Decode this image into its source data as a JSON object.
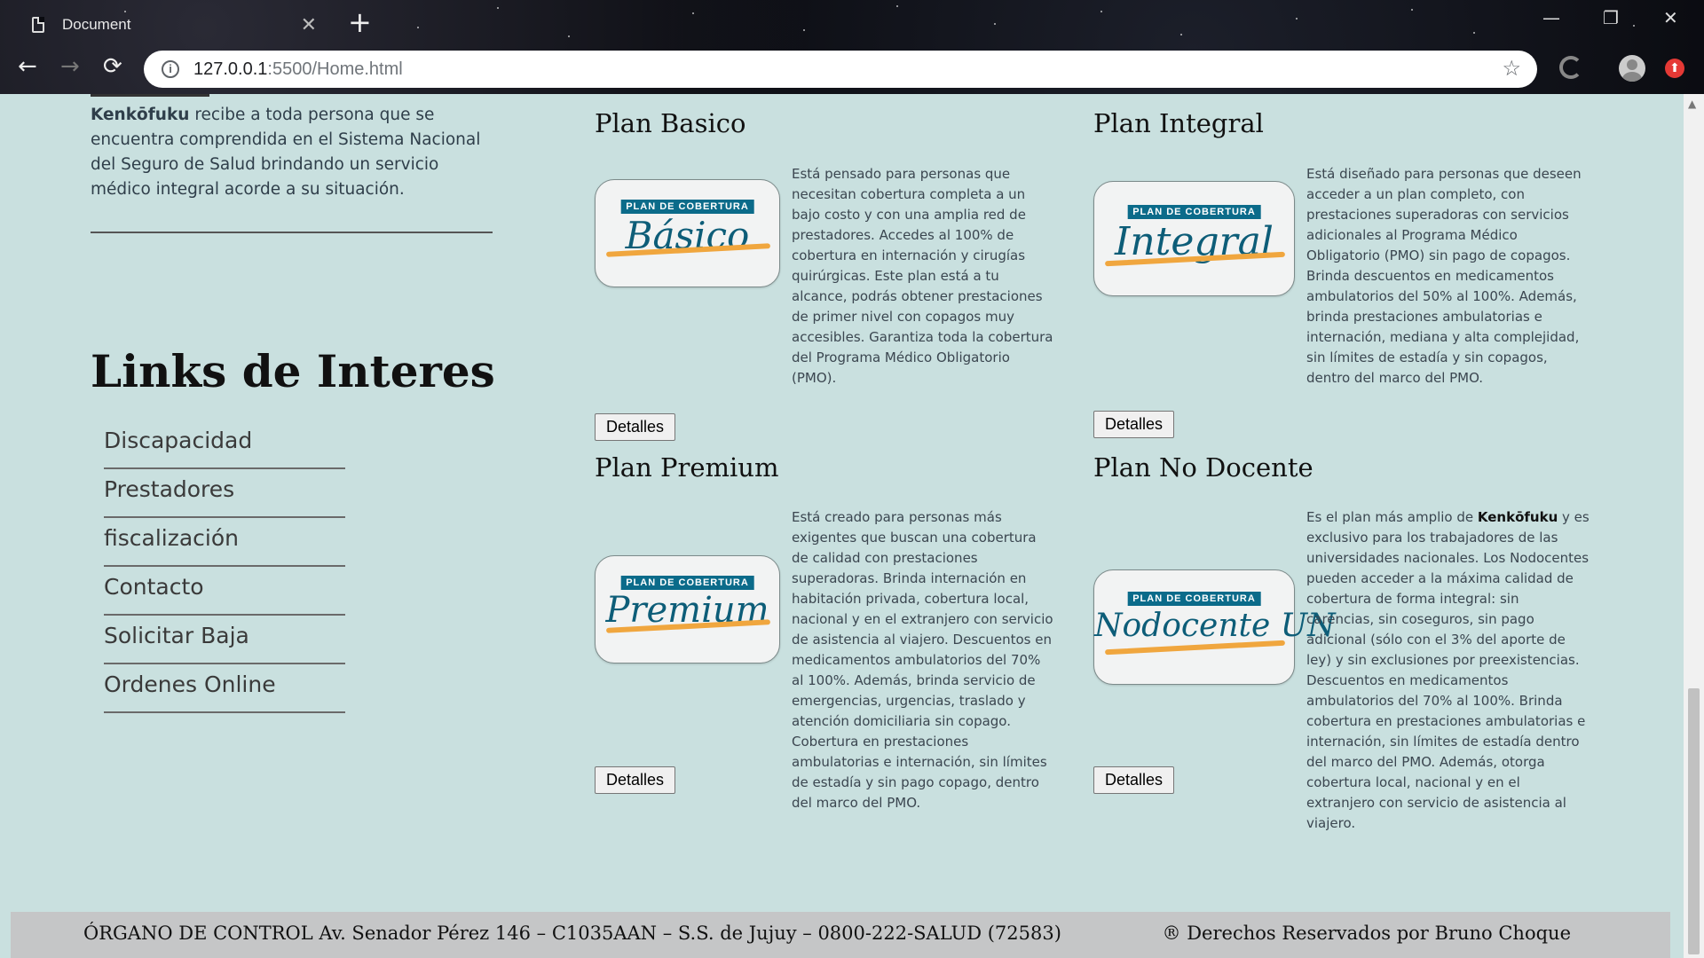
{
  "browser": {
    "tab_title": "Document",
    "tab_close": "✕",
    "new_tab": "+",
    "url_host": "127.0.0.1",
    "url_path": ":5500/Home.html",
    "window_controls": [
      "—",
      "❐",
      "✕"
    ]
  },
  "intro": {
    "brand": "Kenkōfuku",
    "text": " recibe a toda persona que se encuentra comprendida en el Sistema Nacional del Seguro de Salud brindando un servicio médico integral acorde a su situación."
  },
  "links": {
    "title": "Links de Interes",
    "items": [
      "Discapacidad",
      "Prestadores",
      "fiscalización",
      "Contacto",
      "Solicitar Baja",
      "Ordenes Online"
    ]
  },
  "plans": [
    {
      "title": "Plan Basico",
      "logo_tag": "PLAN DE COBERTURA",
      "logo_script": "Básico",
      "description": "Está pensado para personas que necesitan cobertura completa a un bajo costo y con una amplia red de prestadores. Accedes al 100% de cobertura en internación y cirugías quirúrgicas. Este plan está a tu alcance, podrás obtener prestaciones de primer nivel con copagos muy accesibles. Garantiza toda la cobertura del Programa Médico Obligatorio (PMO).",
      "button": "Detalles"
    },
    {
      "title": "Plan Integral",
      "logo_tag": "PLAN DE COBERTURA",
      "logo_script": "Integral",
      "description": "Está diseñado para personas que deseen acceder a un plan completo, con prestaciones superadoras con servicios adicionales al Programa Médico Obligatorio (PMO) sin pago de copagos. Brinda descuentos en medicamentos ambulatorios del 50% al 100%. Además, brinda prestaciones ambulatorias e internación, mediana y alta complejidad, sin límites de estadía y sin copagos, dentro del marco del PMO.",
      "button": "Detalles"
    },
    {
      "title": "Plan Premium",
      "logo_tag": "PLAN DE COBERTURA",
      "logo_script": "Premium",
      "description": "Está creado para personas más exigentes que buscan una cobertura de calidad con prestaciones superadoras. Brinda internación en habitación privada, cobertura local, nacional y en el extranjero con servicio de asistencia al viajero. Descuentos en medicamentos ambulatorios del 70% al 100%. Además, brinda servicio de emergencias, urgencias, traslado y atención domiciliaria sin copago. Cobertura en prestaciones ambulatorias e internación, sin límites de estadía y sin pago copago, dentro del marco del PMO.",
      "button": "Detalles"
    },
    {
      "title": "Plan No Docente",
      "logo_tag": "PLAN DE COBERTURA",
      "logo_script": "Nodocente UN",
      "description_pre": "Es el plan más amplio de ",
      "description_brand": "Kenkōfuku",
      "description_post": " y es exclusivo para los trabajadores de las universidades nacionales. Los Nodocentes pueden acceder a la máxima calidad de cobertura de forma integral: sin carencias, sin coseguros, sin pago adicional (sólo con el 3% del aporte de ley) y sin exclusiones por preexistencias. Descuentos en medicamentos ambulatorios del 70% al 100%. Brinda cobertura en prestaciones ambulatorias e internación, sin límites de estadía dentro del marco del PMO. Además, otorga cobertura local, nacional y en el extranjero con servicio de asistencia al viajero.",
      "button": "Detalles"
    }
  ],
  "footer": {
    "left": "ÓRGANO DE CONTROL Av. Senador Pérez 146 – C1035AAN – S.S. de Jujuy – 0800-222-SALUD (72583)",
    "right": "® Derechos Reservados por Bruno Choque"
  },
  "colors": {
    "page_bg": "#c9e0df",
    "footer_bg": "#c5c6c7",
    "logo_blue": "#0b6b8a",
    "logo_orange": "#f0a63e"
  }
}
